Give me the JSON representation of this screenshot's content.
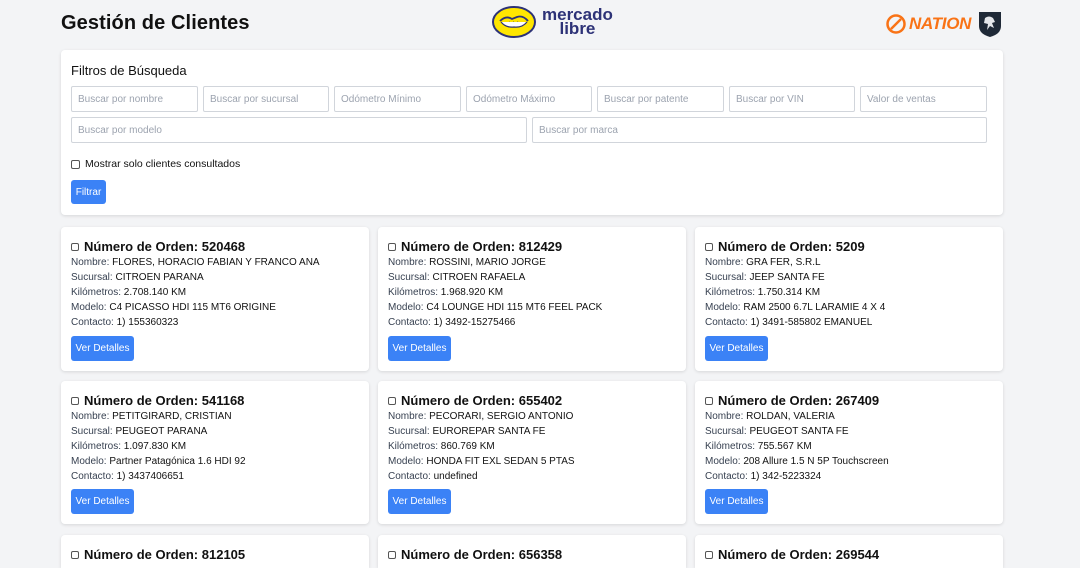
{
  "header": {
    "title": "Gestión de Clientes",
    "ml_logo_line1": "mercado",
    "ml_logo_line2": "libre",
    "nation_logo": "NATION",
    "colors": {
      "ml_yellow": "#ffe600",
      "ml_navy": "#2d3277",
      "nation_orange": "#f97316"
    }
  },
  "filters": {
    "title": "Filtros de Búsqueda",
    "inputs": [
      {
        "placeholder": "Buscar por nombre",
        "value": ""
      },
      {
        "placeholder": "Buscar por sucursal",
        "value": ""
      },
      {
        "placeholder": "Odómetro Mínimo",
        "value": ""
      },
      {
        "placeholder": "Odómetro Máximo",
        "value": ""
      },
      {
        "placeholder": "Buscar por patente",
        "value": ""
      },
      {
        "placeholder": "Buscar por VIN",
        "value": ""
      },
      {
        "placeholder": "Valor de ventas",
        "value": ""
      },
      {
        "placeholder": "Buscar por modelo",
        "value": ""
      },
      {
        "placeholder": "Buscar por marca",
        "value": ""
      }
    ],
    "checkbox_label": "Mostrar solo clientes consultados",
    "button_label": "Filtrar"
  },
  "labels": {
    "order_prefix": "Número de Orden: ",
    "name": "Nombre: ",
    "branch": "Sucursal: ",
    "km": "Kilómetros: ",
    "model": "Modelo: ",
    "contact": "Contacto: ",
    "details_button": "Ver Detalles"
  },
  "cards": [
    {
      "order": "520468",
      "name": "FLORES, HORACIO FABIAN Y FRANCO ANA",
      "branch": "CITROEN PARANA",
      "km": "2.708.140 KM",
      "model": "C4 PICASSO HDI 115 MT6 ORIGINE",
      "contact": "1) 155360323"
    },
    {
      "order": "812429",
      "name": "ROSSINI, MARIO JORGE",
      "branch": "CITROEN RAFAELA",
      "km": "1.968.920 KM",
      "model": "C4 LOUNGE HDI 115 MT6 FEEL PACK",
      "contact": "1) 3492-15275466"
    },
    {
      "order": "5209",
      "name": "GRA FER, S.R.L",
      "branch": "JEEP SANTA FE",
      "km": "1.750.314 KM",
      "model": "RAM 2500 6.7L LARAMIE 4 X 4",
      "contact": "1) 3491-585802 EMANUEL"
    },
    {
      "order": "541168",
      "name": "PETITGIRARD, CRISTIAN",
      "branch": "PEUGEOT PARANA",
      "km": "1.097.830 KM",
      "model": "Partner Patagónica 1.6 HDI 92",
      "contact": "1) 3437406651"
    },
    {
      "order": "655402",
      "name": "PECORARI, SERGIO ANTONIO",
      "branch": "EUROREPAR SANTA FE",
      "km": "860.769 KM",
      "model": "HONDA FIT EXL SEDAN 5 PTAS",
      "contact": "undefined"
    },
    {
      "order": "267409",
      "name": "ROLDAN, VALERIA",
      "branch": "PEUGEOT SANTA FE",
      "km": "755.567 KM",
      "model": "208 Allure 1.5 N 5P Touchscreen",
      "contact": "1) 342-5223324"
    },
    {
      "order": "812105"
    },
    {
      "order": "656358"
    },
    {
      "order": "269544"
    }
  ]
}
